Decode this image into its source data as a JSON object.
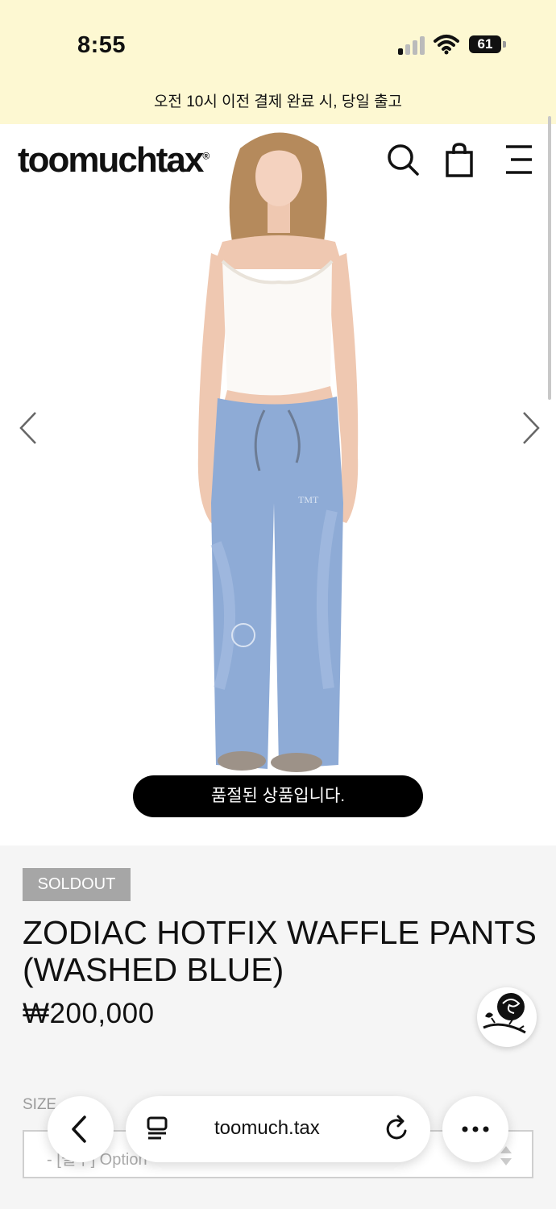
{
  "status_bar": {
    "time": "8:55",
    "battery": "61"
  },
  "notice": "오전 10시 이전 결제 완료 시, 당일 출고",
  "header": {
    "logo": "toomuchtax",
    "logo_mark": "®",
    "icons": [
      "search-icon",
      "shopping-bag-icon",
      "menu-icon"
    ]
  },
  "gallery": {
    "soldout_message": "품절된 상품입니다.",
    "prev_icon": "chevron-left-icon",
    "next_icon": "chevron-right-icon"
  },
  "product": {
    "badge": "SOLDOUT",
    "name": "ZODIAC HOTFIX WAFFLE PANTS (WASHED BLUE)",
    "price": "₩200,000",
    "size_label": "SIZE",
    "size_placeholder": "- [필수] Option"
  },
  "browser_bar": {
    "url": "toomuch.tax",
    "icons": [
      "back-icon",
      "tabs-icon",
      "reload-icon",
      "more-icon"
    ]
  },
  "colors": {
    "notice_bg": "#fdf8d2",
    "badge_bg": "#a6a6a6",
    "pants": "#8eabd6",
    "toast_bg": "#000000"
  }
}
